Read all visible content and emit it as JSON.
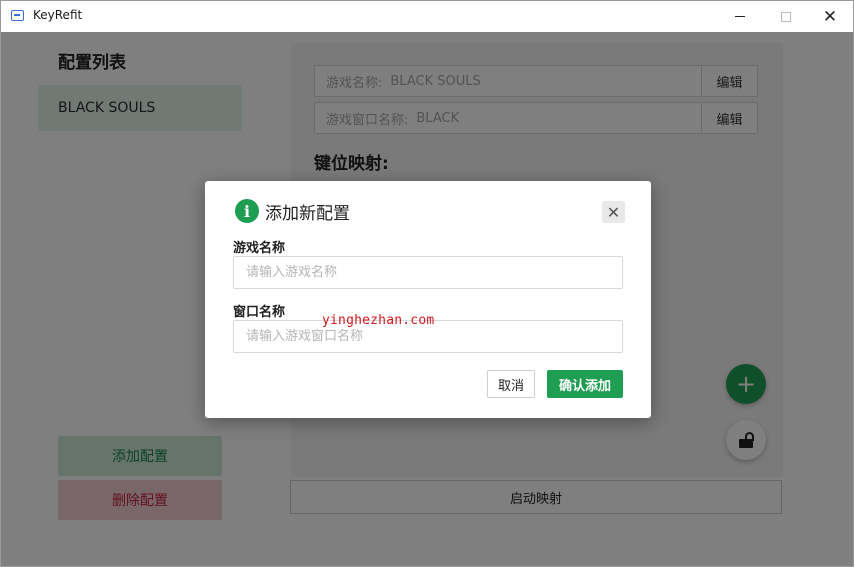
{
  "window": {
    "title": "KeyRefit",
    "close_glyph": "✕"
  },
  "sidebar": {
    "title": "配置列表",
    "items": [
      {
        "label": "BLACK SOULS",
        "selected": true
      }
    ],
    "add_button": "添加配置",
    "delete_button": "删除配置"
  },
  "main": {
    "game_name_label": "游戏名称:",
    "game_name_value": "BLACK SOULS",
    "window_name_label": "游戏窗口名称:",
    "window_name_value": "BLACK",
    "edit_label": "编辑",
    "mapping_title": "键位映射:",
    "start_button": "启动映射",
    "fab_add_glyph": "+"
  },
  "dialog": {
    "title": "添加新配置",
    "info_glyph": "i",
    "close_glyph": "✕",
    "game_name_label": "游戏名称",
    "game_name_placeholder": "请输入游戏名称",
    "window_name_label": "窗口名称",
    "window_name_placeholder": "请输入游戏窗口名称",
    "cancel_button": "取消",
    "confirm_button": "确认添加",
    "watermark": "yinghezhan.com"
  },
  "colors": {
    "accent_green": "#1e9e52",
    "danger_red": "#c0223b",
    "watermark_red": "#d0181e"
  },
  "icons": {
    "app": "keyboard-icon",
    "info": "info-icon",
    "close": "close-icon",
    "add": "plus-icon",
    "lock": "unlock-icon"
  }
}
